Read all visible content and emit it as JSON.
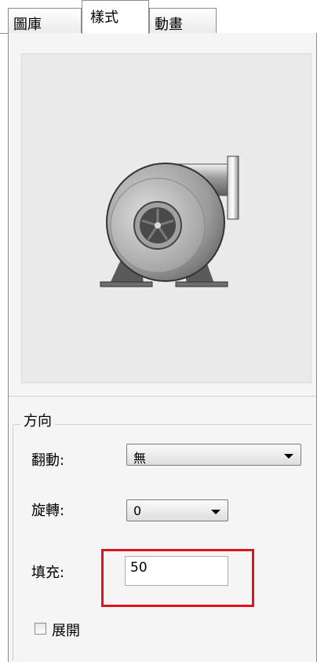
{
  "tabs": [
    {
      "label": "圖庫",
      "active": false
    },
    {
      "label": "樣式",
      "active": true
    },
    {
      "label": "動畫",
      "active": false
    }
  ],
  "preview": {
    "icon": "pump-icon"
  },
  "direction_group": {
    "title": "方向"
  },
  "fields": {
    "flip": {
      "label": "翻動:",
      "value": "無"
    },
    "rotate": {
      "label": "旋轉:",
      "value": "0"
    },
    "fill": {
      "label": "填充:",
      "value": "50"
    }
  },
  "expand": {
    "label": "展開",
    "checked": false
  }
}
